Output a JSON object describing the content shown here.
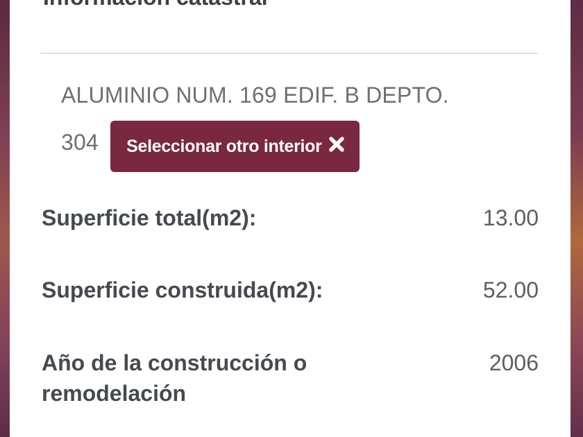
{
  "panel": {
    "title": "Información catastral"
  },
  "address": {
    "line": "ALUMINIO NUM. 169 EDIF. B DEPTO.",
    "number": "304",
    "select_button_label": "Seleccionar otro interior"
  },
  "details": [
    {
      "label": "Superficie total(m2):",
      "value": "13.00"
    },
    {
      "label": "Superficie construida(m2):",
      "value": "52.00"
    },
    {
      "label": "Año de la construcción o remodelación",
      "value": "2006"
    }
  ],
  "colors": {
    "button_bg": "#7a2740",
    "button_text": "#ffffff",
    "background_accent": "#7a3a4e"
  },
  "icons": {
    "select_button_icon": "close-icon"
  }
}
